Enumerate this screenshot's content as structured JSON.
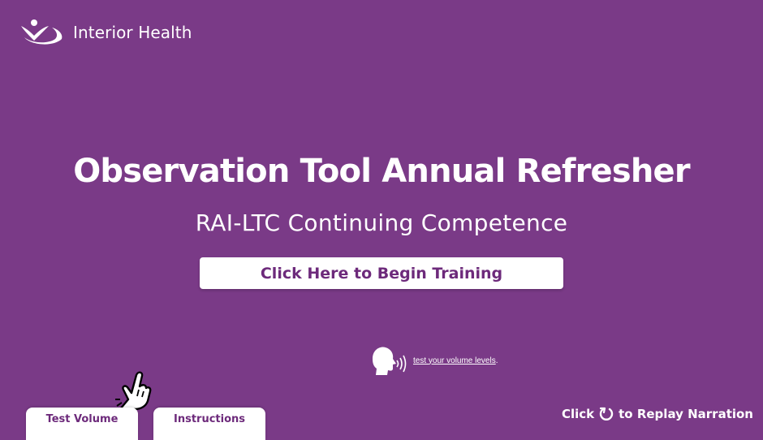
{
  "brand": {
    "logo_icon": "interior-health-logo",
    "name": "Interior Health"
  },
  "main": {
    "title": "Observation Tool Annual Refresher",
    "subtitle": "RAI-LTC Continuing Competence",
    "begin_button_label": "Click Here to Begin Training"
  },
  "volume_hint": {
    "icon": "speaking-head-icon",
    "link_text": "test your volume levels",
    "suffix": "."
  },
  "pointer": {
    "icon": "hand-pointer-icon"
  },
  "bottom_tabs": {
    "test_volume_label": "Test Volume",
    "instructions_label": "Instructions"
  },
  "replay": {
    "prefix": "Click",
    "icon": "replay-icon",
    "suffix": "to Replay Narration"
  },
  "colors": {
    "background": "#7a3a87",
    "button_text": "#6d2a7b",
    "text": "#ffffff"
  }
}
